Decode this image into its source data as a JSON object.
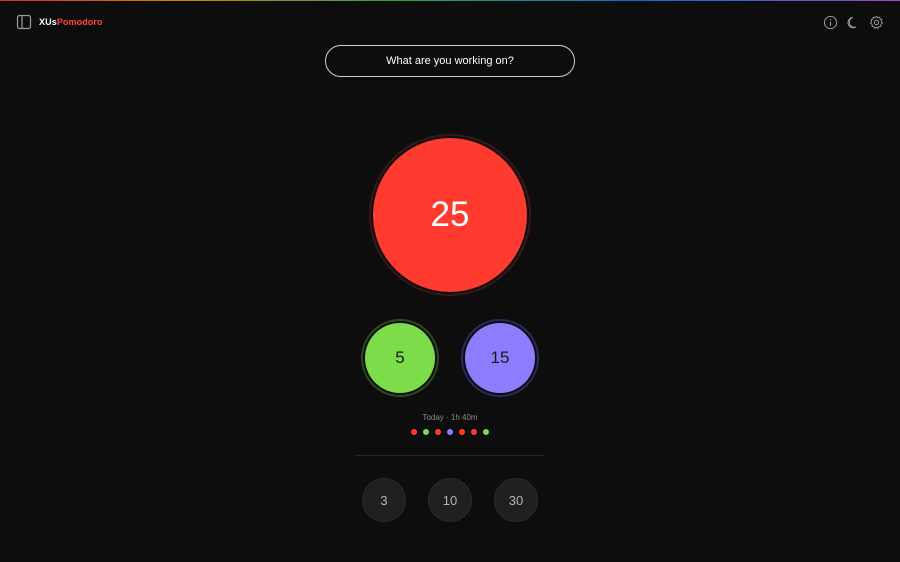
{
  "app": {
    "logo_part1": "XUs",
    "logo_part2": "Pomodoro"
  },
  "topbar": {
    "icons": [
      "sidebar-icon",
      "info-icon",
      "moon-icon",
      "gear-icon"
    ]
  },
  "task": {
    "placeholder": "What are you working on?"
  },
  "timers": {
    "focus": {
      "label": "25",
      "color": "#ff3b30"
    },
    "short_break": {
      "label": "5",
      "color": "#7ddc4a"
    },
    "long_break": {
      "label": "15",
      "color": "#8e7cff"
    }
  },
  "today": {
    "summary": "Today · 1h 40m",
    "sessions": [
      "#ff3b30",
      "#7ddc4a",
      "#ff3b30",
      "#8e7cff",
      "#ff3b30",
      "#ff3b30",
      "#7ddc4a"
    ]
  },
  "presets": [
    "3",
    "10",
    "30"
  ],
  "colors": {
    "background": "#0d0d0d",
    "accent": "#ff453a"
  }
}
